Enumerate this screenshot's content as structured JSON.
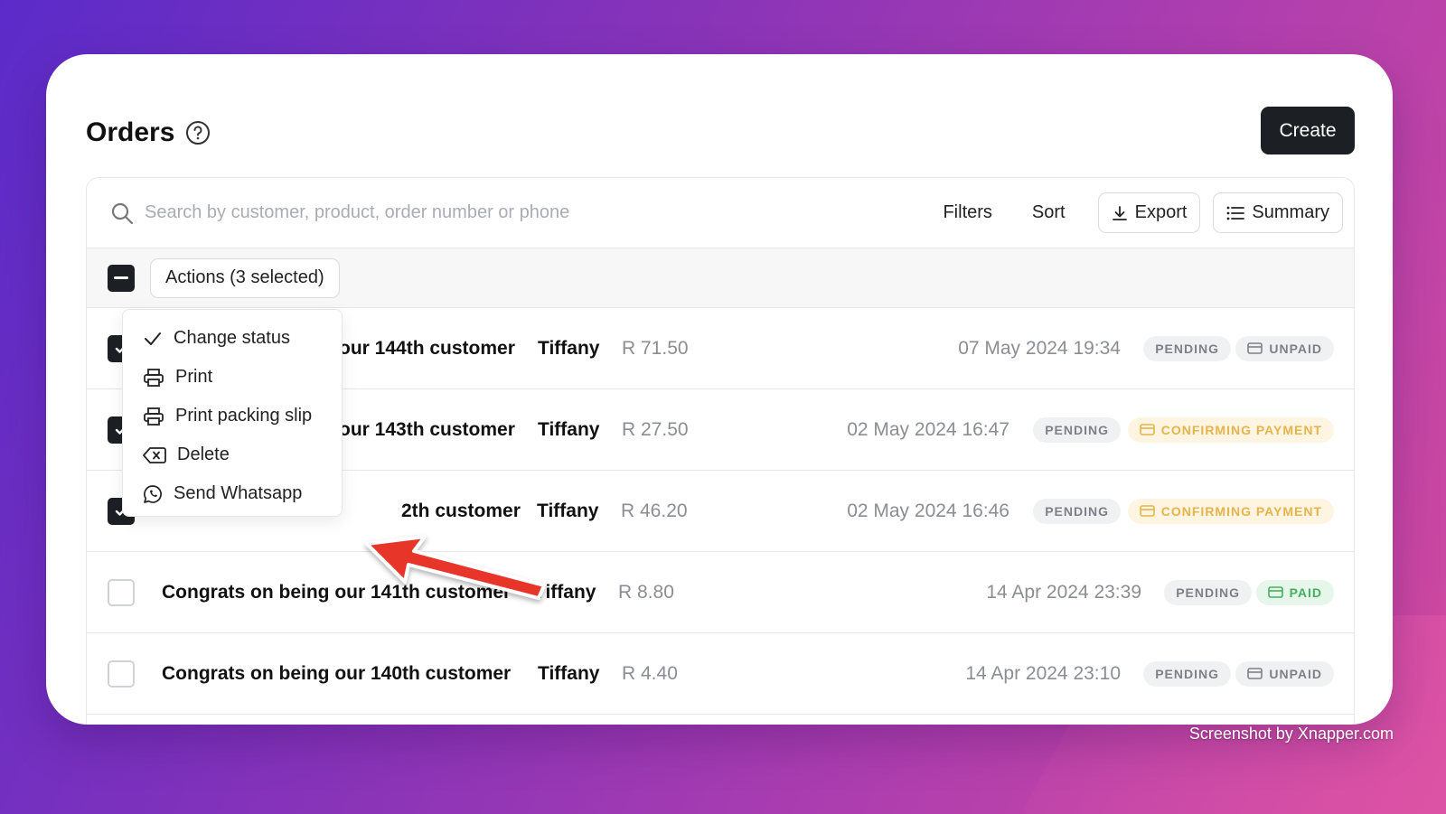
{
  "page": {
    "title": "Orders",
    "create_label": "Create"
  },
  "toolbar": {
    "search_placeholder": "Search by customer, product, order number or phone",
    "filters_label": "Filters",
    "sort_label": "Sort",
    "export_label": "Export",
    "summary_label": "Summary"
  },
  "bulk": {
    "actions_label": "Actions (3 selected)"
  },
  "menu": {
    "items": [
      {
        "label": "Change status",
        "icon": "check-icon"
      },
      {
        "label": "Print",
        "icon": "printer-icon"
      },
      {
        "label": "Print packing slip",
        "icon": "printer-icon"
      },
      {
        "label": "Delete",
        "icon": "delete-icon"
      },
      {
        "label": "Send Whatsapp",
        "icon": "whatsapp-icon"
      }
    ]
  },
  "orders": [
    {
      "title": "Congrats on being our 144th customer",
      "visible_title": "our 144th customer",
      "customer": "Tiffany",
      "amount": "R 71.50",
      "date": "07 May 2024 19:34",
      "status": "PENDING",
      "payment": "UNPAID",
      "checked": true
    },
    {
      "title": "Congrats on being our 143th customer",
      "visible_title": "our 143th customer",
      "customer": "Tiffany",
      "amount": "R 27.50",
      "date": "02 May 2024 16:47",
      "status": "PENDING",
      "payment": "CONFIRMING PAYMENT",
      "checked": true
    },
    {
      "title": "Congrats on being our 142th customer",
      "visible_title": "2th customer",
      "customer": "Tiffany",
      "amount": "R 46.20",
      "date": "02 May 2024 16:46",
      "status": "PENDING",
      "payment": "CONFIRMING PAYMENT",
      "checked": true
    },
    {
      "title": "Congrats on being our 141th customer",
      "customer": "Tiffany",
      "amount": "R 8.80",
      "date": "14 Apr 2024 23:39",
      "status": "PENDING",
      "payment": "PAID",
      "checked": false
    },
    {
      "title": "Congrats on being our 140th customer",
      "customer": "Tiffany",
      "amount": "R 4.40",
      "date": "14 Apr 2024 23:10",
      "status": "PENDING",
      "payment": "UNPAID",
      "checked": false
    }
  ],
  "watermark": "Screenshot by Xnapper.com",
  "colors": {
    "primary_dark": "#1c1f24",
    "confirming": "#e6b44a",
    "paid": "#43b05c",
    "annotation_arrow": "#e8352c"
  }
}
